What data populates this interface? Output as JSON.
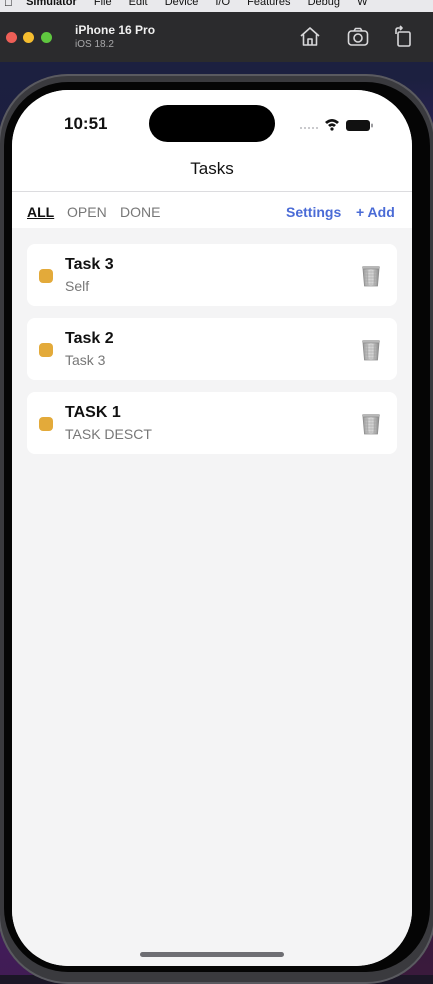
{
  "menubar": {
    "app": "Simulator",
    "items": [
      "File",
      "Edit",
      "Device",
      "I/O",
      "Features",
      "Debug",
      "W"
    ]
  },
  "simulator": {
    "device_name": "iPhone 16 Pro",
    "os_version": "iOS 18.2",
    "toolbar_icons": [
      "home-icon",
      "screenshot-icon",
      "rotate-icon"
    ]
  },
  "status_bar": {
    "time": "10:51",
    "icons": [
      "signal-icon",
      "wifi-icon",
      "battery-icon"
    ]
  },
  "nav": {
    "title": "Tasks"
  },
  "filters": {
    "all": "ALL",
    "open": "OPEN",
    "done": "DONE",
    "active": "ALL"
  },
  "actions": {
    "settings": "Settings",
    "add": "+ Add"
  },
  "tasks": [
    {
      "title": "Task 3",
      "subtitle": "Self",
      "color": "#e3aa3a"
    },
    {
      "title": "Task 2",
      "subtitle": "Task 3",
      "color": "#e3aa3a"
    },
    {
      "title": "TASK 1",
      "subtitle": "TASK DESCT",
      "color": "#e3aa3a"
    }
  ],
  "colors": {
    "accent": "#4a6bd6",
    "task_dot": "#e3aa3a"
  }
}
